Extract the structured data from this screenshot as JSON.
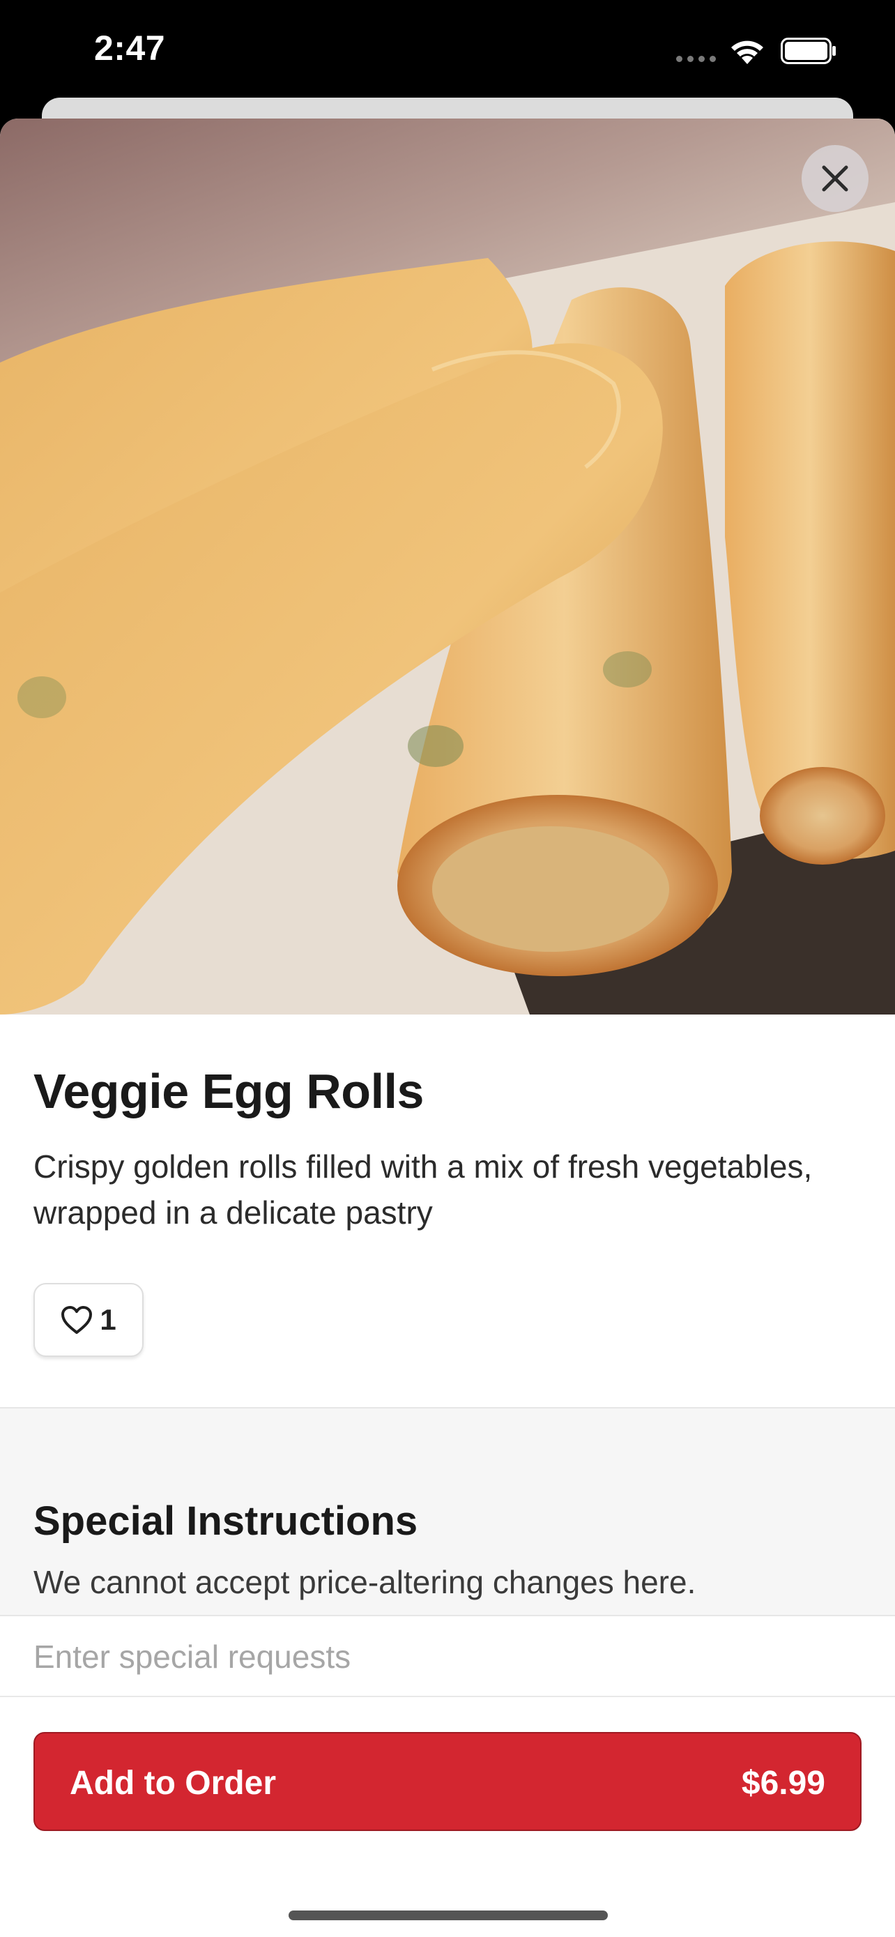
{
  "status_bar": {
    "time": "2:47"
  },
  "item": {
    "title": "Veggie Egg Rolls",
    "description": "Crispy golden rolls filled with a mix of fresh vegetables, wrapped in a delicate pastry",
    "like_count": "1"
  },
  "special_instructions": {
    "title": "Special Instructions",
    "subtitle": "We cannot accept price-altering changes here.",
    "placeholder": "Enter special requests",
    "value": ""
  },
  "footer": {
    "add_label": "Add to Order",
    "price": "$6.99"
  },
  "colors": {
    "accent": "#d32630",
    "text_primary": "#1a1a1a",
    "section_bg": "#f6f6f6"
  },
  "icons": {
    "close": "close-icon",
    "like": "heart-icon",
    "wifi": "wifi-icon",
    "battery": "battery-icon"
  }
}
